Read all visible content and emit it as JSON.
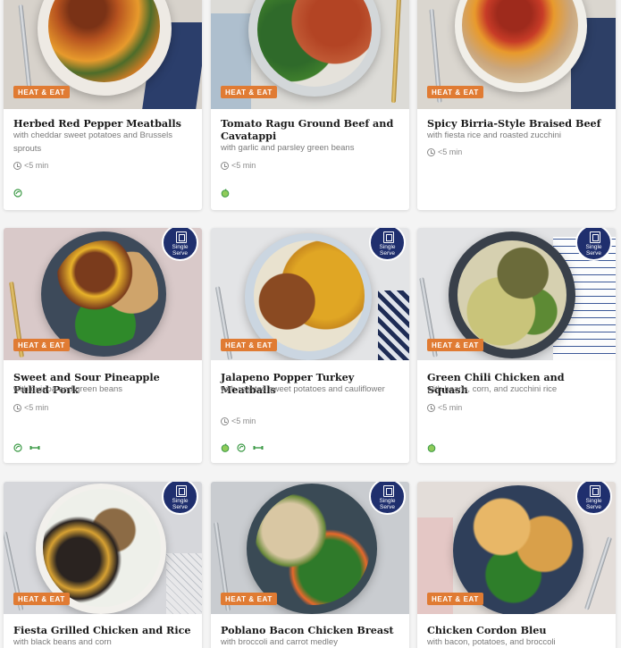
{
  "cards": [
    {
      "tag": "HEAT & EAT",
      "title": "Herbed Red Pepper Meatballs",
      "subtitle": "with cheddar sweet potatoes and Brussels sprouts",
      "time": "<5 min",
      "badge": null,
      "icons": [
        "low-carb-icon"
      ]
    },
    {
      "tag": "HEAT & EAT",
      "title": "Tomato Ragu Ground Beef and Cavatappi",
      "subtitle": "with garlic and parsley green beans",
      "time": "<5 min",
      "badge": null,
      "icons": [
        "apple-icon"
      ]
    },
    {
      "tag": "HEAT & EAT",
      "title": "Spicy Birria-Style Braised Beef",
      "subtitle": "with fiesta rice and roasted zucchini",
      "time": "<5 min",
      "badge": null,
      "icons": []
    },
    {
      "tag": "HEAT & EAT",
      "title": "Sweet and Sour Pineapple Pulled Pork",
      "subtitle": "with quinoa and green beans",
      "time": "<5 min",
      "badge": [
        "Single",
        "Serve"
      ],
      "icons": [
        "low-carb-icon",
        "protein-icon"
      ]
    },
    {
      "tag": "HEAT & EAT",
      "title": "Jalapeno Popper Turkey Meatballs",
      "subtitle": "with roasted sweet potatoes and cauliflower",
      "time": "<5 min",
      "badge": [
        "Single",
        "Serve"
      ],
      "icons": [
        "apple-icon",
        "low-carb-icon",
        "protein-icon"
      ]
    },
    {
      "tag": "HEAT & EAT",
      "title": "Green Chili Chicken and Squash",
      "subtitle": "with beans, corn, and zucchini rice",
      "time": "<5 min",
      "badge": [
        "Single",
        "Serve"
      ],
      "icons": [
        "apple-icon"
      ]
    },
    {
      "tag": "HEAT & EAT",
      "title": "Fiesta Grilled Chicken and Rice",
      "subtitle": "with black beans and corn",
      "time": "",
      "badge": [
        "Single",
        "Serve"
      ],
      "icons": []
    },
    {
      "tag": "HEAT & EAT",
      "title": "Poblano Bacon Chicken Breast",
      "subtitle": "with broccoli and carrot medley",
      "time": "",
      "badge": [
        "Single",
        "Serve"
      ],
      "icons": []
    },
    {
      "tag": "HEAT & EAT",
      "title": "Chicken Cordon Bleu",
      "subtitle": "with bacon, potatoes, and broccoli",
      "time": "",
      "badge": [
        "Single",
        "Serve"
      ],
      "icons": []
    }
  ],
  "colors": {
    "tag": "#e07b33",
    "badge": "#1f2f6e",
    "icon_green": "#3c9a46"
  }
}
